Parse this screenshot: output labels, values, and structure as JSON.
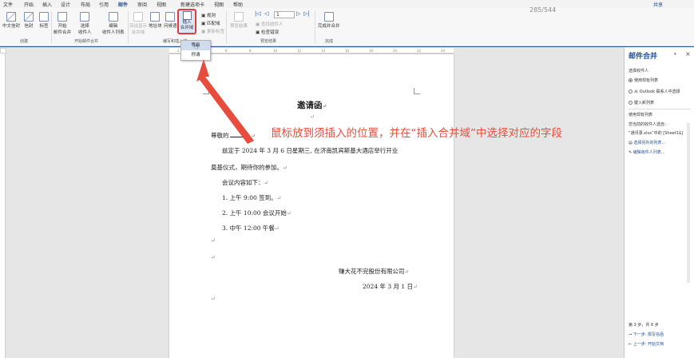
{
  "menu": {
    "items": [
      "文件",
      "开始",
      "插入",
      "设计",
      "布局",
      "引用",
      "邮件",
      "审阅",
      "视图",
      "新建选项卡",
      "视图",
      "帮助"
    ],
    "active_index": 6,
    "share": "共享"
  },
  "page_counter": "285/544",
  "ribbon": {
    "create": {
      "label": "创建",
      "buttons": [
        "中文信封",
        "信封",
        "标签"
      ]
    },
    "start_merge": {
      "label": "开始邮件合并",
      "buttons": [
        "开始\n邮件合并",
        "选择\n收件人",
        "编辑\n收件人列表"
      ]
    },
    "write_insert": {
      "label": "编写和插入域",
      "buttons": [
        "突出显示\n合并域",
        "地址块",
        "问候语"
      ],
      "insert_button": "插入\n合并域",
      "small": [
        "规则",
        "匹配域",
        "更新标签"
      ]
    },
    "preview": {
      "label": "预览结果",
      "preview_button": "预览结果",
      "record_value": "1",
      "small": [
        "查找收件人",
        "检查错误"
      ]
    },
    "finish": {
      "label": "完成",
      "button": "完成并合并"
    }
  },
  "dropdown": {
    "options": [
      "等级",
      "称谓"
    ],
    "highlighted_index": 0
  },
  "document": {
    "title": "邀请函",
    "greeting": "尊敬的",
    "greeting_suffix": "，",
    "para1_line1": "兹定于 2024 年 3 月 6 日星期三, 在济南凯宾斯基大酒店举行开业",
    "para1_line2": "奠基仪式，期待你的参加。",
    "agenda_heading": "会议内容如下：",
    "agenda_items": [
      "1. 上午 9:00 签到。",
      "2. 上午 10:00 会议开始",
      "3. 中午 12:00 午餐"
    ],
    "company": "赚大花不完股份有限公司",
    "date": "2024 年 3 月 1 日",
    "para_mark": "↵"
  },
  "annotation": {
    "text": "鼠标放到须插入的位置，并在“插入合并域”中选择对应的字段",
    "color": "#e84c3d"
  },
  "pane": {
    "title": "邮件合并",
    "close": "×",
    "select_recipients": "选择收件人",
    "options": [
      "使用现有列表",
      "从 Outlook 联系人中选择",
      "键入新列表"
    ],
    "selected_option": 0,
    "use_existing": "使用现有列表",
    "current_from": "您当前的收件人选自：",
    "source": "“通讯录.xlsx”中的 [Sheet1$]",
    "links": [
      "选择另外的列表...",
      "编辑收件人列表..."
    ],
    "step": "第 3 步，共 6 步",
    "next": "下一步: 撰写信函",
    "prev": "上一步: 开始文档"
  }
}
